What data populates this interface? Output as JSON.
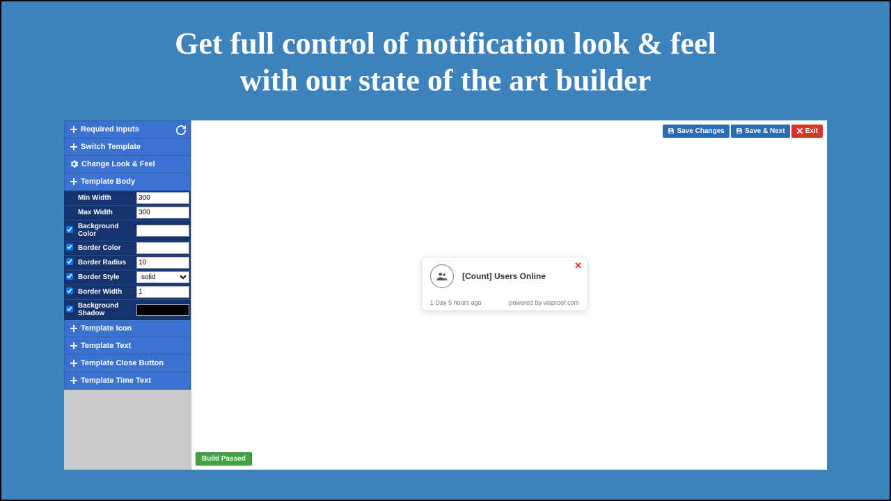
{
  "hero": {
    "line1": "Get full control of notification look & feel",
    "line2": "with our state of the art builder"
  },
  "sidebar": {
    "required_inputs": "Required Inputs",
    "switch_template": "Switch Template",
    "change_look_feel": "Change Look & Feel",
    "template_body": "Template Body",
    "template_icon": "Template Icon",
    "template_text": "Template Text",
    "template_close": "Template Close Button",
    "template_time": "Template Time Text",
    "body_props": {
      "min_width_label": "Min Width",
      "min_width_value": "300",
      "max_width_label": "Max Width",
      "max_width_value": "300",
      "bg_color_label": "Background Color",
      "border_color_label": "Border Color",
      "border_radius_label": "Border Radius",
      "border_radius_value": "10",
      "border_style_label": "Border Style",
      "border_style_value": "solid",
      "border_width_label": "Border Width",
      "border_width_value": "1",
      "bg_shadow_label": "Background Shadow"
    }
  },
  "toolbar": {
    "save_changes": "Save Changes",
    "save_next": "Save & Next",
    "exit": "Exit"
  },
  "notification": {
    "title": "[Count] Users Online",
    "time_ago": "1 Day 5 hours ago",
    "powered_by": "powered by viaproof.com"
  },
  "status": {
    "build_passed": "Build Passed"
  }
}
